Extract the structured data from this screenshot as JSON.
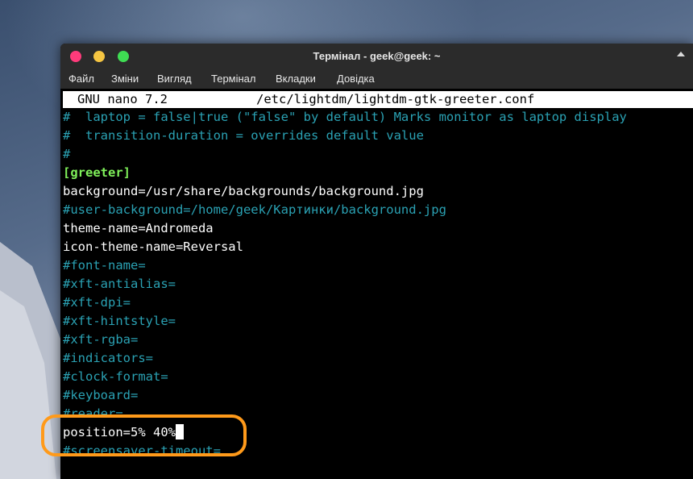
{
  "window": {
    "title": "Термінал - geek@geek: ~",
    "menu": [
      "Файл",
      "Зміни",
      "Вигляд",
      "Термінал",
      "Вкладки",
      "Довідка"
    ]
  },
  "nano": {
    "header_left": "GNU nano 7.2",
    "header_file": "/etc/lightdm/lightdm-gtk-greeter.conf"
  },
  "lines": [
    {
      "text": "#  laptop = false|true (\"false\" by default) Marks monitor as laptop display",
      "style": "comment"
    },
    {
      "text": "#  transition-duration = overrides default value",
      "style": "comment"
    },
    {
      "text": "#",
      "style": "comment"
    },
    {
      "text": "[greeter]",
      "style": "section"
    },
    {
      "text": "background=/usr/share/backgrounds/background.jpg",
      "style": "white"
    },
    {
      "text": "#user-background=/home/geek/Картинки/background.jpg",
      "style": "comment"
    },
    {
      "text": "theme-name=Andromeda",
      "style": "white"
    },
    {
      "text": "icon-theme-name=Reversal",
      "style": "white"
    },
    {
      "text": "#font-name=",
      "style": "comment"
    },
    {
      "text": "#xft-antialias=",
      "style": "comment"
    },
    {
      "text": "#xft-dpi=",
      "style": "comment"
    },
    {
      "text": "#xft-hintstyle=",
      "style": "comment"
    },
    {
      "text": "#xft-rgba=",
      "style": "comment"
    },
    {
      "text": "#indicators=",
      "style": "comment"
    },
    {
      "text": "#clock-format=",
      "style": "comment"
    },
    {
      "text": "#keyboard=",
      "style": "comment"
    },
    {
      "text": "#reader=",
      "style": "comment"
    },
    {
      "text": "position=5% 40%",
      "style": "white",
      "cursor": true
    },
    {
      "text": "#screensaver-timeout=",
      "style": "comment"
    }
  ],
  "colors": {
    "comment": "#2aa1b3",
    "section": "#7ff05a",
    "highlight": "#ff9a1a"
  }
}
